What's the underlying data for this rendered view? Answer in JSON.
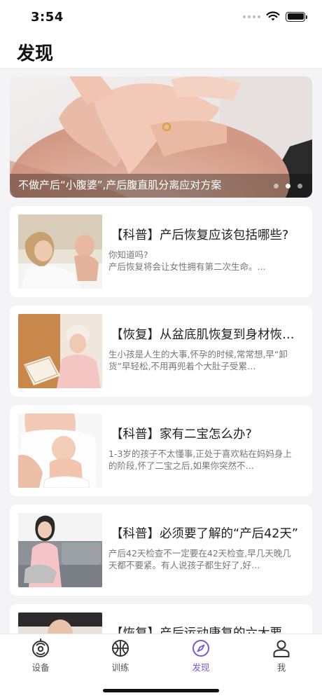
{
  "status": {
    "time": "3:54"
  },
  "header": {
    "title": "发现"
  },
  "banner": {
    "caption": "不做产后“小腹婆”,产后腹直肌分离应对方案",
    "dots": 3,
    "active_dot": 1
  },
  "articles": [
    {
      "title": "【科普】产后恢复应该包括哪些?",
      "desc": "你知道吗?\n产后恢复将会让女性拥有第二次生命。..."
    },
    {
      "title": "【恢复】从盆底肌恢复到身材恢…",
      "desc": "生小孩是人生的大事,怀孕的时候,常常想,早“卸货”早轻松,不用再兜着个大肚子受累…"
    },
    {
      "title": "【科普】家有二宝怎么办?",
      "desc": "1-3岁的孩子不太懂事,正处于喜欢粘在妈妈身上的阶段,怀了二宝之后,如果你突然不…"
    },
    {
      "title": "【科普】必须要了解的“产后42天”",
      "desc": "产后42天检查不一定要在42天检查,早几天晚几天都不要紧。有人说孩子都生好了,好…"
    },
    {
      "title": "【恢复】产后运动康复的六大要…",
      "desc": ""
    }
  ],
  "tabbar": {
    "items": [
      {
        "label": "设备",
        "icon": "device-icon"
      },
      {
        "label": "训练",
        "icon": "basketball-icon"
      },
      {
        "label": "发现",
        "icon": "compass-icon"
      },
      {
        "label": "我",
        "icon": "person-icon"
      }
    ],
    "active_index": 2,
    "accent_color": "#7b55d6",
    "inactive_color": "#333333"
  }
}
